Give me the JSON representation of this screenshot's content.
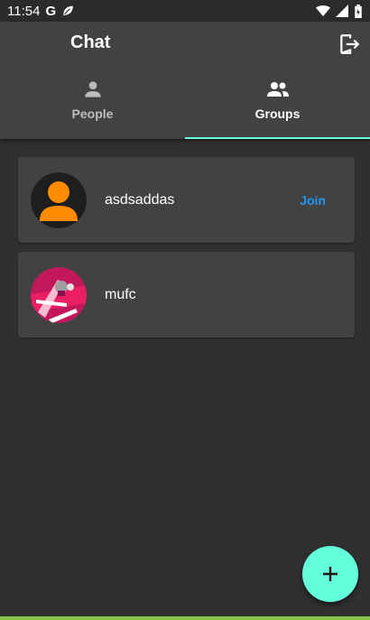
{
  "status_bar": {
    "time": "11:54",
    "g_letter": "G"
  },
  "app_bar": {
    "title": "Chat",
    "logout_icon": "logout-icon"
  },
  "tabs": [
    {
      "label": "People",
      "icon": "person-icon",
      "active": false
    },
    {
      "label": "Groups",
      "icon": "group-icon",
      "active": true
    }
  ],
  "groups": [
    {
      "name": "asdsaddas",
      "action": "Join",
      "avatar": "default-person-avatar"
    },
    {
      "name": "mufc",
      "action": "",
      "avatar": "pink-illustration-avatar"
    }
  ],
  "fab": {
    "icon": "plus-icon"
  },
  "colors": {
    "accent": "#64ffda",
    "join": "#2196f3",
    "avatar_orange": "#ff8c00",
    "background": "#303030",
    "card": "#424242"
  }
}
